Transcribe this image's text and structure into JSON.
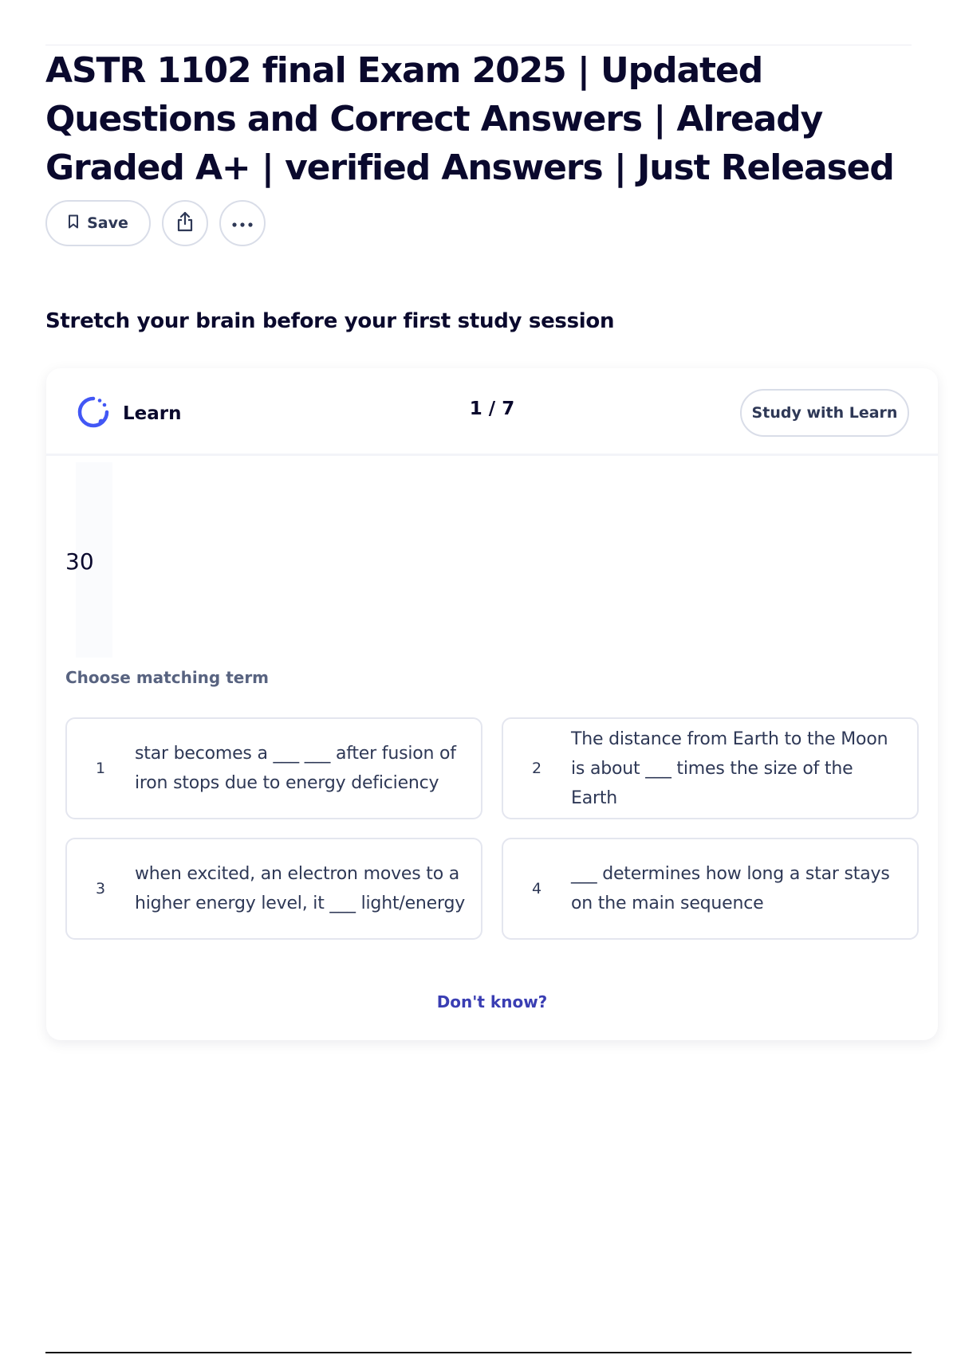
{
  "page": {
    "title": "ASTR 1102 final Exam 2025 | Updated Questions and Correct Answers | Already Graded A+ | verified Answers | Just Released"
  },
  "actions": {
    "save_label": "Save",
    "share_icon": "share-icon",
    "more_icon": "more-icon"
  },
  "section": {
    "heading": "Stretch your brain before your first study session"
  },
  "learn_card": {
    "mode_label": "Learn",
    "progress": "1 / 7",
    "study_button": "Study with Learn",
    "term": "30",
    "choose_label": "Choose matching term",
    "options": [
      {
        "number": "1",
        "text": "star becomes a ___ ___ after fusion of iron stops due to energy deficiency"
      },
      {
        "number": "2",
        "text": "The distance from Earth to the Moon is about ___ times the size of the Earth"
      },
      {
        "number": "3",
        "text": "when excited, an electron moves to a higher energy level, it ___ light/energy"
      },
      {
        "number": "4",
        "text": "___ determines how long a star stays on the main sequence"
      }
    ],
    "dont_know": "Don't know?"
  },
  "colors": {
    "title_text": "#0a092d",
    "muted_text": "#586380",
    "link": "#3a3eb3",
    "learn_icon": "#4257f5",
    "border": "#d9dde8"
  }
}
